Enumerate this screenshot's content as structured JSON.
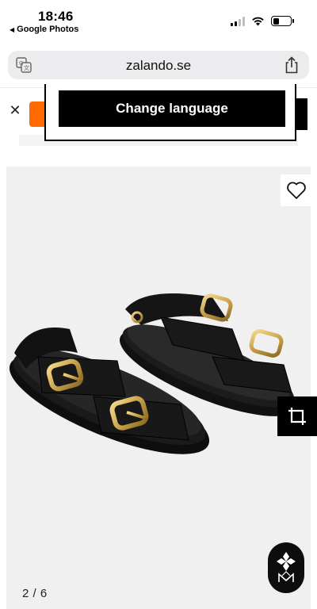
{
  "status_bar": {
    "time": "18:46",
    "back_app": "Google Photos",
    "back_icon": "back-triangle-icon",
    "battery_percent": 38
  },
  "browser": {
    "url": "zalando.se",
    "icons": [
      "translate-icon",
      "share-icon"
    ]
  },
  "banner": {
    "close_icon": "close-icon",
    "change_language_label": "Change language"
  },
  "product": {
    "image_counter": "2 / 6",
    "icons": [
      "heart-icon",
      "crop-icon",
      "brand-logo-icon"
    ]
  },
  "colors": {
    "accent_orange": "#ff6900",
    "button_black": "#000000",
    "address_bar_bg": "#ececee",
    "image_bg": "#f0f0f0"
  }
}
